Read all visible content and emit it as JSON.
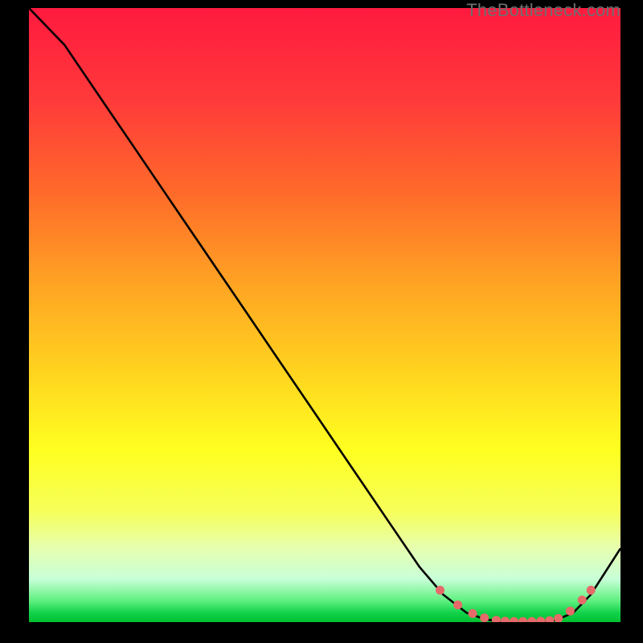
{
  "watermark": "TheBottleneck.com",
  "chart_data": {
    "type": "line",
    "title": "",
    "xlabel": "",
    "ylabel": "",
    "xlim": [
      0,
      100
    ],
    "ylim": [
      0,
      100
    ],
    "grid": false,
    "series": [
      {
        "name": "curve",
        "x": [
          0,
          6,
          12,
          18,
          24,
          30,
          36,
          42,
          48,
          54,
          60,
          66,
          70,
          74,
          77,
          80,
          83,
          86,
          89,
          92,
          95,
          100
        ],
        "y": [
          100,
          94,
          85.5,
          77,
          68.5,
          60,
          51.5,
          43,
          34.5,
          26,
          17.5,
          9,
          4.5,
          1.5,
          0.5,
          0,
          0,
          0,
          0.3,
          1.5,
          4.5,
          12
        ]
      }
    ],
    "markers": {
      "name": "dots",
      "x": [
        69.5,
        72.5,
        75,
        77,
        79,
        80.5,
        82,
        83.5,
        85,
        86.5,
        88,
        89.5,
        91.5,
        93.5,
        95
      ],
      "y": [
        5.2,
        2.8,
        1.4,
        0.7,
        0.3,
        0.15,
        0.1,
        0.1,
        0.1,
        0.15,
        0.25,
        0.6,
        1.8,
        3.6,
        5.2
      ]
    },
    "gradient_stops": [
      {
        "offset": 0.0,
        "color": "#ff1a3f"
      },
      {
        "offset": 0.15,
        "color": "#ff3a3a"
      },
      {
        "offset": 0.3,
        "color": "#ff6a2a"
      },
      {
        "offset": 0.45,
        "color": "#ffa423"
      },
      {
        "offset": 0.6,
        "color": "#ffd61f"
      },
      {
        "offset": 0.72,
        "color": "#ffff20"
      },
      {
        "offset": 0.82,
        "color": "#f6ff5a"
      },
      {
        "offset": 0.88,
        "color": "#e6ffb0"
      },
      {
        "offset": 0.93,
        "color": "#c8ffd8"
      },
      {
        "offset": 0.965,
        "color": "#60f080"
      },
      {
        "offset": 0.985,
        "color": "#12d24a"
      },
      {
        "offset": 1.0,
        "color": "#00c030"
      }
    ]
  }
}
